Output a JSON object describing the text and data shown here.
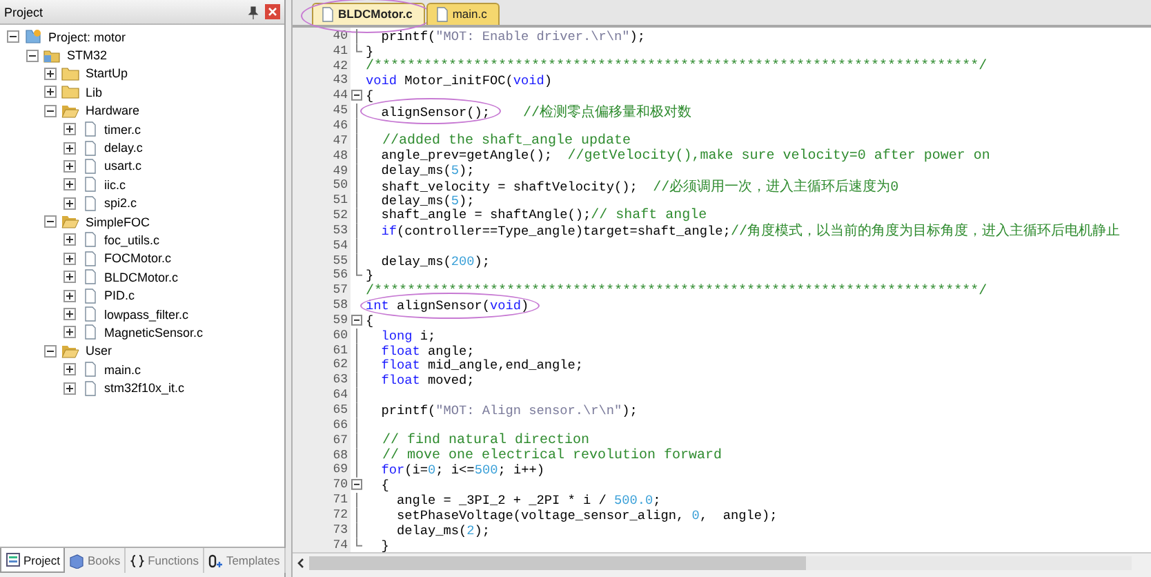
{
  "project_panel": {
    "title": "Project",
    "tree": [
      {
        "label": "Project: motor",
        "kind": "project",
        "expanded": true,
        "children": [
          {
            "label": "STM32",
            "kind": "target",
            "expanded": true,
            "children": [
              {
                "label": "StartUp",
                "kind": "group",
                "expanded": false
              },
              {
                "label": "Lib",
                "kind": "group",
                "expanded": false
              },
              {
                "label": "Hardware",
                "kind": "group",
                "expanded": true,
                "children": [
                  {
                    "label": "timer.c",
                    "kind": "file",
                    "expanded": false
                  },
                  {
                    "label": "delay.c",
                    "kind": "file",
                    "expanded": false
                  },
                  {
                    "label": "usart.c",
                    "kind": "file",
                    "expanded": false
                  },
                  {
                    "label": "iic.c",
                    "kind": "file",
                    "expanded": false
                  },
                  {
                    "label": "spi2.c",
                    "kind": "file",
                    "expanded": false
                  }
                ]
              },
              {
                "label": "SimpleFOC",
                "kind": "group",
                "expanded": true,
                "children": [
                  {
                    "label": "foc_utils.c",
                    "kind": "file",
                    "expanded": false
                  },
                  {
                    "label": "FOCMotor.c",
                    "kind": "file",
                    "expanded": false
                  },
                  {
                    "label": "BLDCMotor.c",
                    "kind": "file",
                    "expanded": false
                  },
                  {
                    "label": "PID.c",
                    "kind": "file",
                    "expanded": false
                  },
                  {
                    "label": "lowpass_filter.c",
                    "kind": "file",
                    "expanded": false
                  },
                  {
                    "label": "MagneticSensor.c",
                    "kind": "file",
                    "expanded": false
                  }
                ]
              },
              {
                "label": "User",
                "kind": "group",
                "expanded": true,
                "children": [
                  {
                    "label": "main.c",
                    "kind": "file",
                    "expanded": false
                  },
                  {
                    "label": "stm32f10x_it.c",
                    "kind": "file",
                    "expanded": false
                  }
                ]
              }
            ]
          }
        ]
      }
    ],
    "bottom_tabs": [
      {
        "label": "Project",
        "kind": "project",
        "selected": true
      },
      {
        "label": "Books",
        "kind": "books",
        "selected": false
      },
      {
        "label": "Functions",
        "kind": "functions",
        "selected": false
      },
      {
        "label": "Templates",
        "kind": "templates",
        "selected": false
      }
    ]
  },
  "editor": {
    "tabs": [
      {
        "label": "BLDCMotor.c",
        "selected": true,
        "circled": true
      },
      {
        "label": "main.c",
        "selected": false,
        "circled": false
      }
    ],
    "lines": [
      {
        "n": "40",
        "kind": "body",
        "segs": [
          {
            "t": "  printf(",
            "kind": "plain"
          },
          {
            "t": "\"MOT: Enable driver.\\r\\n\"",
            "kind": "string"
          },
          {
            "t": ");",
            "kind": "plain"
          }
        ]
      },
      {
        "n": "41",
        "kind": "block_end",
        "segs": [
          {
            "t": "}",
            "kind": "plain"
          }
        ]
      },
      {
        "n": "42",
        "kind": "plain",
        "segs": [
          {
            "t": "/*************************************************************************/",
            "kind": "comment"
          }
        ]
      },
      {
        "n": "43",
        "kind": "plain",
        "segs": [
          {
            "t": "void",
            "kind": "keyword"
          },
          {
            "t": " Motor_initFOC(",
            "kind": "plain"
          },
          {
            "t": "void",
            "kind": "keyword"
          },
          {
            "t": ")",
            "kind": "plain"
          }
        ]
      },
      {
        "n": "44",
        "kind": "block_start",
        "segs": [
          {
            "t": "{",
            "kind": "plain"
          }
        ]
      },
      {
        "n": "45",
        "kind": "body",
        "segs": [
          {
            "t": "  alignSensor();",
            "kind": "plain",
            "circled": true
          },
          {
            "t": "    //检测零点偏移量和极对数",
            "kind": "comment"
          }
        ]
      },
      {
        "n": "46",
        "kind": "body"
      },
      {
        "n": "47",
        "kind": "body",
        "segs": [
          {
            "t": "  //added the shaft_angle update",
            "kind": "comment"
          }
        ]
      },
      {
        "n": "48",
        "kind": "body",
        "segs": [
          {
            "t": "  angle_prev=getAngle();  ",
            "kind": "plain"
          },
          {
            "t": "//getVelocity(),make sure velocity=0 after power on",
            "kind": "comment"
          }
        ]
      },
      {
        "n": "49",
        "kind": "body",
        "segs": [
          {
            "t": "  delay_ms(",
            "kind": "plain"
          },
          {
            "t": "5",
            "kind": "number"
          },
          {
            "t": ");",
            "kind": "plain"
          }
        ]
      },
      {
        "n": "50",
        "kind": "body",
        "segs": [
          {
            "t": "  shaft_velocity = shaftVelocity();  ",
            "kind": "plain"
          },
          {
            "t": "//必须调用一次，进入主循环后速度为0",
            "kind": "comment"
          }
        ]
      },
      {
        "n": "51",
        "kind": "body",
        "segs": [
          {
            "t": "  delay_ms(",
            "kind": "plain"
          },
          {
            "t": "5",
            "kind": "number"
          },
          {
            "t": ");",
            "kind": "plain"
          }
        ]
      },
      {
        "n": "52",
        "kind": "body",
        "segs": [
          {
            "t": "  shaft_angle = shaftAngle();",
            "kind": "plain"
          },
          {
            "t": "// shaft angle",
            "kind": "comment"
          }
        ]
      },
      {
        "n": "53",
        "kind": "body",
        "segs": [
          {
            "t": "  if",
            "kind": "keyword"
          },
          {
            "t": "(controller==Type_angle)target=shaft_angle;",
            "kind": "plain"
          },
          {
            "t": "//角度模式，以当前的角度为目标角度，进入主循环后电机静止",
            "kind": "comment"
          }
        ]
      },
      {
        "n": "54",
        "kind": "body"
      },
      {
        "n": "55",
        "kind": "body",
        "segs": [
          {
            "t": "  delay_ms(",
            "kind": "plain"
          },
          {
            "t": "200",
            "kind": "number"
          },
          {
            "t": ");",
            "kind": "plain"
          }
        ]
      },
      {
        "n": "56",
        "kind": "block_end",
        "segs": [
          {
            "t": "}",
            "kind": "plain"
          }
        ]
      },
      {
        "n": "57",
        "kind": "plain",
        "segs": [
          {
            "t": "/*************************************************************************/",
            "kind": "comment"
          }
        ]
      },
      {
        "n": "58",
        "kind": "plain",
        "segs": [
          {
            "t": "int",
            "kind": "keyword",
            "circled": true
          },
          {
            "t": " alignSensor(",
            "kind": "plain",
            "circled": true
          },
          {
            "t": "void",
            "kind": "keyword",
            "circled": true
          },
          {
            "t": ")",
            "kind": "plain",
            "circled": true
          }
        ]
      },
      {
        "n": "59",
        "kind": "block_start",
        "segs": [
          {
            "t": "{",
            "kind": "plain"
          }
        ]
      },
      {
        "n": "60",
        "kind": "body",
        "segs": [
          {
            "t": "  long",
            "kind": "keyword"
          },
          {
            "t": " i;",
            "kind": "plain"
          }
        ]
      },
      {
        "n": "61",
        "kind": "body",
        "segs": [
          {
            "t": "  float",
            "kind": "keyword"
          },
          {
            "t": " angle;",
            "kind": "plain"
          }
        ]
      },
      {
        "n": "62",
        "kind": "body",
        "segs": [
          {
            "t": "  float",
            "kind": "keyword"
          },
          {
            "t": " mid_angle,end_angle;",
            "kind": "plain"
          }
        ]
      },
      {
        "n": "63",
        "kind": "body",
        "segs": [
          {
            "t": "  float",
            "kind": "keyword"
          },
          {
            "t": " moved;",
            "kind": "plain"
          }
        ]
      },
      {
        "n": "64",
        "kind": "body"
      },
      {
        "n": "65",
        "kind": "body",
        "segs": [
          {
            "t": "  printf(",
            "kind": "plain"
          },
          {
            "t": "\"MOT: Align sensor.\\r\\n\"",
            "kind": "string"
          },
          {
            "t": ");",
            "kind": "plain"
          }
        ]
      },
      {
        "n": "66",
        "kind": "body"
      },
      {
        "n": "67",
        "kind": "body",
        "segs": [
          {
            "t": "  // find natural direction",
            "kind": "comment"
          }
        ]
      },
      {
        "n": "68",
        "kind": "body",
        "segs": [
          {
            "t": "  // move one electrical revolution forward",
            "kind": "comment"
          }
        ]
      },
      {
        "n": "69",
        "kind": "body",
        "segs": [
          {
            "t": "  for",
            "kind": "keyword"
          },
          {
            "t": "(i=",
            "kind": "plain"
          },
          {
            "t": "0",
            "kind": "number"
          },
          {
            "t": "; i<=",
            "kind": "plain"
          },
          {
            "t": "500",
            "kind": "number"
          },
          {
            "t": "; i++)",
            "kind": "plain"
          }
        ]
      },
      {
        "n": "70",
        "kind": "block_start",
        "segs": [
          {
            "t": "  {",
            "kind": "plain"
          }
        ]
      },
      {
        "n": "71",
        "kind": "body",
        "segs": [
          {
            "t": "    angle = _3PI_2 + _2PI * i / ",
            "kind": "plain"
          },
          {
            "t": "500.0",
            "kind": "number"
          },
          {
            "t": ";",
            "kind": "plain"
          }
        ]
      },
      {
        "n": "72",
        "kind": "body",
        "segs": [
          {
            "t": "    setPhaseVoltage(voltage_sensor_align, ",
            "kind": "plain"
          },
          {
            "t": "0",
            "kind": "number"
          },
          {
            "t": ",  angle);",
            "kind": "plain"
          }
        ]
      },
      {
        "n": "73",
        "kind": "body",
        "segs": [
          {
            "t": "    delay_ms(",
            "kind": "plain"
          },
          {
            "t": "2",
            "kind": "number"
          },
          {
            "t": ");",
            "kind": "plain"
          }
        ]
      },
      {
        "n": "74",
        "kind": "block_end",
        "segs": [
          {
            "t": "  }",
            "kind": "plain"
          }
        ]
      }
    ]
  }
}
